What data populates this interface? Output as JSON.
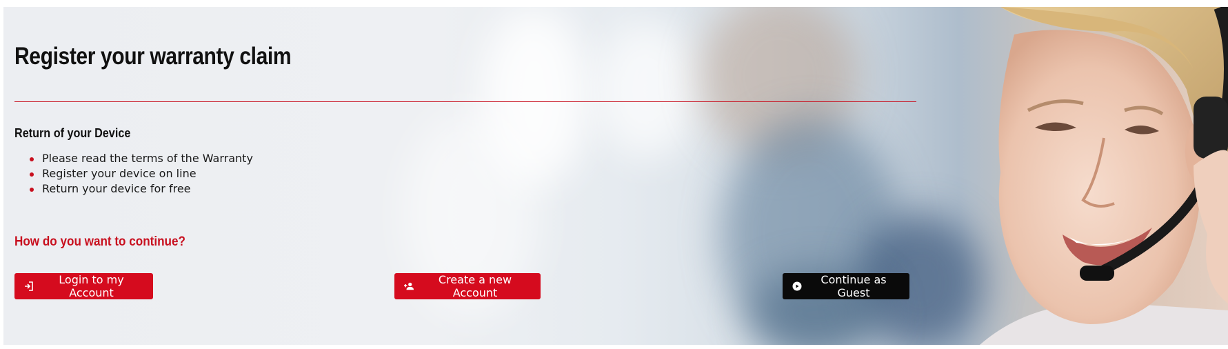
{
  "page": {
    "title": "Register your warranty claim",
    "section_title": "Return of your Device",
    "bullets": [
      "Please read the terms of the Warranty",
      "Register your device on line",
      "Return your device for free"
    ],
    "question": "How do you want to continue?"
  },
  "actions": {
    "login": {
      "label": "Login to my Account",
      "icon": "login-icon"
    },
    "create": {
      "label": "Create a new Account",
      "icon": "add-user-icon"
    },
    "guest": {
      "label": "Continue as Guest",
      "icon": "play-circle-icon"
    }
  },
  "colors": {
    "accent": "#d50b1e",
    "guest_button": "#0a0a0a",
    "text": "#111111"
  }
}
